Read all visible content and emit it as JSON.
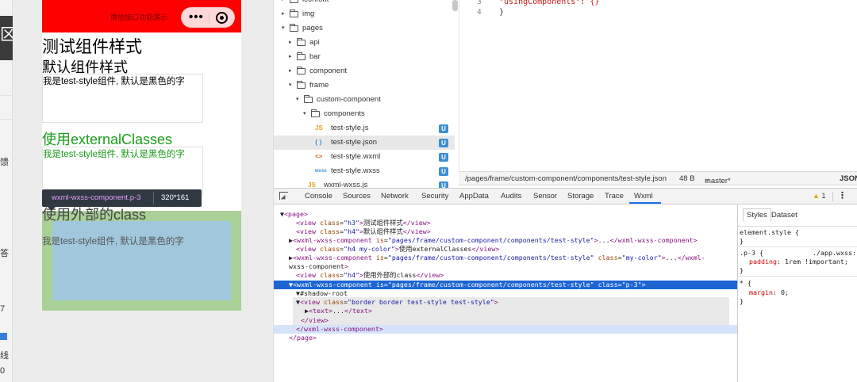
{
  "left_strip": {
    "chars": [
      "区",
      "馈",
      "答",
      "7",
      "线",
      "0"
    ]
  },
  "simulator": {
    "nav_tip": "微信接口功能演示",
    "capsule_dots": "•••",
    "h3_default": "测试组件样式",
    "h4_default": "默认组件样式",
    "comp_text_1": "我是test-style组件, 默认是黑色的字",
    "h4_external": "使用externalClasses",
    "comp_text_2": "我是test-style组件, 默认是黑色的字",
    "h4_outer": "使用外部的class",
    "comp_text_3": "我是test-style组件, 默认是黑色的字",
    "tooltip_name": "wxml-wxss-component.p-3",
    "tooltip_size": "320*161",
    "colors": {
      "nav": "#ff0000",
      "green_text": "#1a9c1a",
      "padding_hl": "#93c47d",
      "content_hl": "#9fc5e8"
    }
  },
  "file_tree": {
    "rows": [
      {
        "label": "iconfont",
        "arrow": "▸",
        "type": "folder",
        "indent": 0
      },
      {
        "label": "img",
        "arrow": "▸",
        "type": "folder",
        "indent": 0
      },
      {
        "label": "pages",
        "arrow": "▾",
        "type": "folder-open",
        "indent": 0
      },
      {
        "label": "api",
        "arrow": "▸",
        "type": "folder",
        "indent": 1
      },
      {
        "label": "bar",
        "arrow": "▸",
        "type": "folder",
        "indent": 1
      },
      {
        "label": "component",
        "arrow": "▸",
        "type": "folder",
        "indent": 1
      },
      {
        "label": "frame",
        "arrow": "▾",
        "type": "folder-open",
        "indent": 1
      },
      {
        "label": "custom-component",
        "arrow": "▾",
        "type": "folder-open",
        "indent": 2
      },
      {
        "label": "components",
        "arrow": "▾",
        "type": "folder-open",
        "indent": 3
      },
      {
        "label": "test-style.js",
        "icon": "JS",
        "type": "js",
        "indent": 4,
        "badge": "U"
      },
      {
        "label": "test-style.json",
        "icon": "{ }",
        "type": "json",
        "indent": 4,
        "badge": "U",
        "selected": true
      },
      {
        "label": "test-style.wxml",
        "icon": "<>",
        "type": "wxml",
        "indent": 4,
        "badge": "U"
      },
      {
        "label": "test-style.wxss",
        "icon": "wxss",
        "type": "wxss",
        "indent": 4,
        "badge": "U"
      },
      {
        "label": "wxml-wxss.js",
        "icon": "JS",
        "type": "js",
        "indent": 3,
        "badge": "U"
      }
    ]
  },
  "editor": {
    "lines": [
      {
        "num": "3",
        "code": "\"usingComponents\": {}"
      },
      {
        "num": "4",
        "code": "}"
      }
    ]
  },
  "status_bar": {
    "path": "/pages/frame/custom-component/components/test-style.json",
    "size": "48 B",
    "branch": "master*",
    "lang": "JSON"
  },
  "devtools": {
    "tabs": [
      "Console",
      "Sources",
      "Network",
      "Security",
      "AppData",
      "Audits",
      "Sensor",
      "Storage",
      "Trace",
      "Wxml"
    ],
    "active_tab": "Wxml",
    "warn_count": "1",
    "dom_lines": [
      "▼<page>",
      "<view class=\"h3\">测试组件样式</view>",
      "<view class=\"h4\">默认组件样式</view>",
      "▶<wxml-wxss-component is=\"pages/frame/custom-component/components/test-style\">...</wxml-wxss-component>",
      "<view class=\"h4 my-color\">使用externalClasses</view>",
      "▶<wxml-wxss-component is=\"pages/frame/custom-component/components/test-style\" class=\"my-color\">...</wxml-",
      "wxss-component>",
      "<view class=\"h4\">使用外部的class</view>",
      "▼<wxml-wxss-component is=\"pages/frame/custom-component/components/test-style\" class=\"p-3\">",
      "▼#shadow-root",
      "▼<view class=\"border border test-style test-style\">",
      "▶<text>...</text>",
      "</view>",
      "</wxml-wxss-component>",
      "</page>"
    ],
    "styles_tabs": [
      "Styles",
      "Dataset"
    ],
    "style_rules": [
      {
        "selector": "element.style {",
        "close": "}"
      },
      {
        "selector": ".p-3 {",
        "source": "./app.wxss:",
        "prop": "padding",
        "value": "1rem !important;",
        "close": "}"
      },
      {
        "selector": "* {",
        "prop": "margin",
        "value": "0;",
        "close": "}"
      }
    ]
  }
}
